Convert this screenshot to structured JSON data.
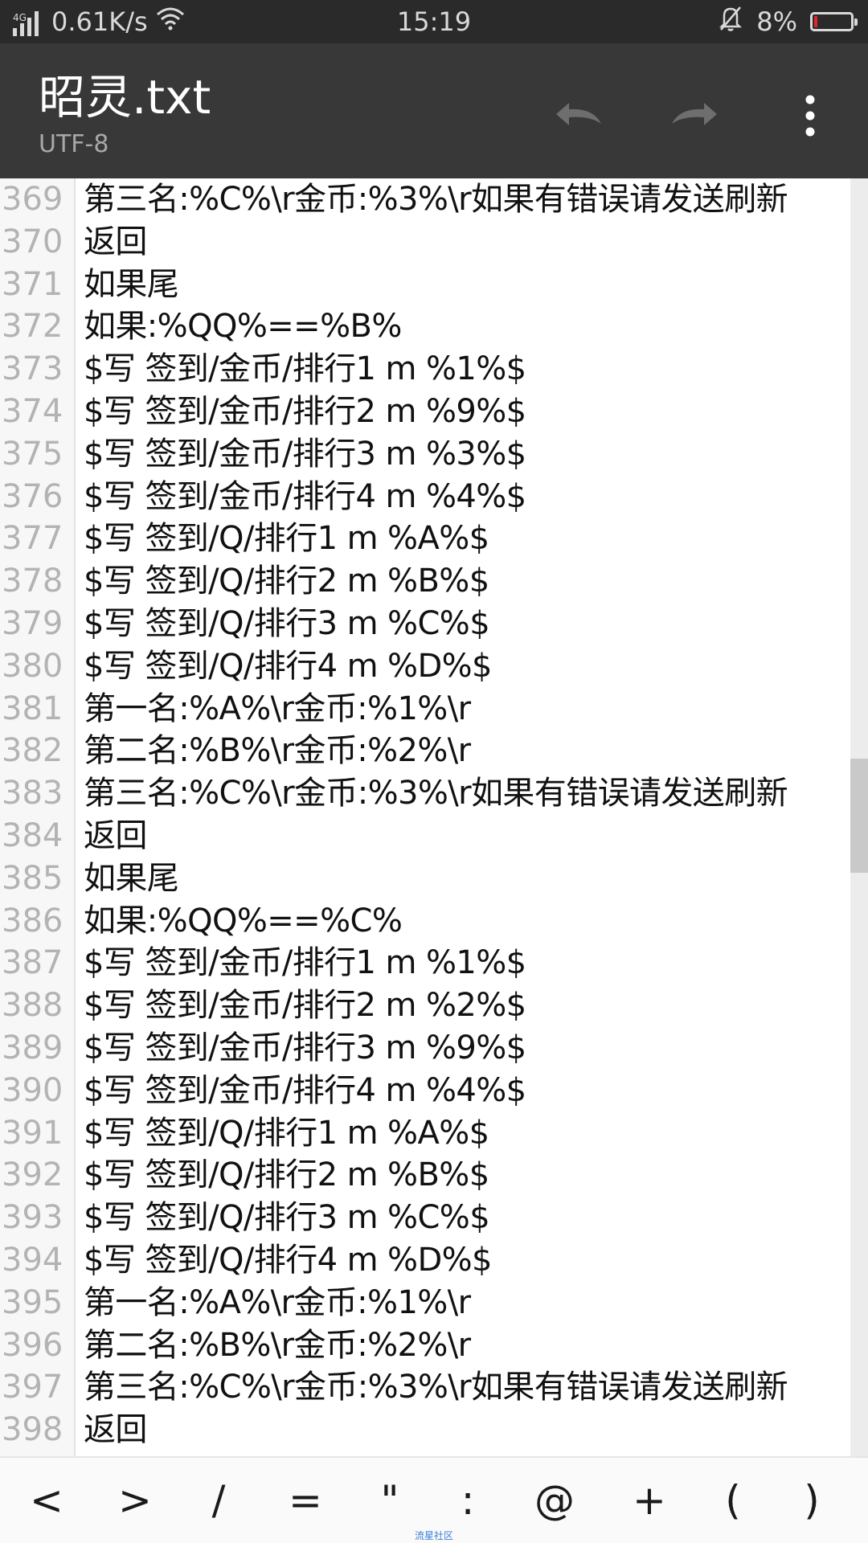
{
  "status_bar": {
    "network_type": "4G",
    "speed": "0.61K/s",
    "time": "15:19",
    "battery": "8%",
    "battery_level": 0.08,
    "battery_color": "#e0262a"
  },
  "app_bar": {
    "title": "昭灵.txt",
    "encoding": "UTF-8"
  },
  "editor": {
    "lines": [
      {
        "num": "369",
        "text": "第三名:%C%\\r金币:%3%\\r如果有错误请发送刷新"
      },
      {
        "num": "370",
        "text": "返回"
      },
      {
        "num": "371",
        "text": "如果尾"
      },
      {
        "num": "372",
        "text": "如果:%QQ%==%B%"
      },
      {
        "num": "373",
        "text": "$写 签到/金币/排行1 m %1%$"
      },
      {
        "num": "374",
        "text": "$写 签到/金币/排行2 m %9%$"
      },
      {
        "num": "375",
        "text": "$写 签到/金币/排行3 m %3%$"
      },
      {
        "num": "376",
        "text": "$写 签到/金币/排行4 m %4%$"
      },
      {
        "num": "377",
        "text": "$写 签到/Q/排行1 m %A%$"
      },
      {
        "num": "378",
        "text": "$写 签到/Q/排行2 m %B%$"
      },
      {
        "num": "379",
        "text": "$写 签到/Q/排行3 m %C%$"
      },
      {
        "num": "380",
        "text": "$写 签到/Q/排行4 m %D%$"
      },
      {
        "num": "381",
        "text": "第一名:%A%\\r金币:%1%\\r"
      },
      {
        "num": "382",
        "text": "第二名:%B%\\r金币:%2%\\r"
      },
      {
        "num": "383",
        "text": "第三名:%C%\\r金币:%3%\\r如果有错误请发送刷新"
      },
      {
        "num": "384",
        "text": "返回"
      },
      {
        "num": "385",
        "text": "如果尾"
      },
      {
        "num": "386",
        "text": "如果:%QQ%==%C%"
      },
      {
        "num": "387",
        "text": "$写 签到/金币/排行1 m %1%$"
      },
      {
        "num": "388",
        "text": "$写 签到/金币/排行2 m %2%$"
      },
      {
        "num": "389",
        "text": "$写 签到/金币/排行3 m %9%$"
      },
      {
        "num": "390",
        "text": "$写 签到/金币/排行4 m %4%$"
      },
      {
        "num": "391",
        "text": "$写 签到/Q/排行1 m %A%$"
      },
      {
        "num": "392",
        "text": "$写 签到/Q/排行2 m %B%$"
      },
      {
        "num": "393",
        "text": "$写 签到/Q/排行3 m %C%$"
      },
      {
        "num": "394",
        "text": "$写 签到/Q/排行4 m %D%$"
      },
      {
        "num": "395",
        "text": "第一名:%A%\\r金币:%1%\\r"
      },
      {
        "num": "396",
        "text": "第二名:%B%\\r金币:%2%\\r"
      },
      {
        "num": "397",
        "text": "第三名:%C%\\r金币:%3%\\r如果有错误请发送刷新"
      },
      {
        "num": "398",
        "text": "返回"
      }
    ]
  },
  "symbol_bar": {
    "keys": [
      "<",
      ">",
      "/",
      "=",
      "\"",
      ":",
      "@",
      "+",
      "(",
      ")"
    ]
  },
  "watermark": "流星社区",
  "icons": {
    "signal": "signal-bars-icon",
    "wifi": "wifi-icon",
    "mute": "bell-muted-icon",
    "undo": "undo-icon",
    "redo": "redo-icon",
    "more": "overflow-dots-icon"
  }
}
